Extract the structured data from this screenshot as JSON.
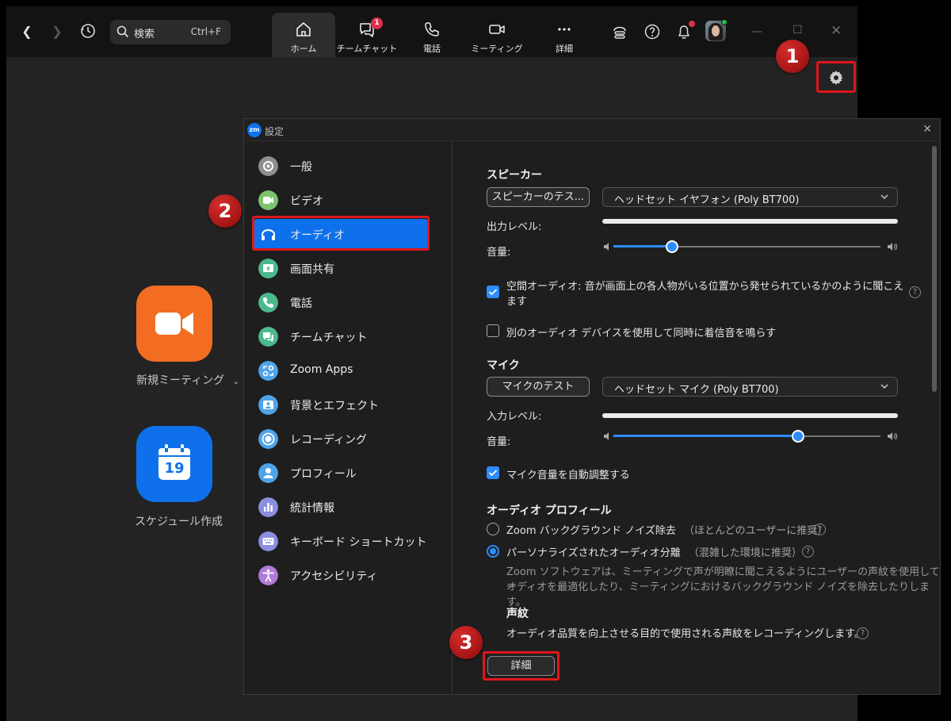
{
  "topbar": {
    "search_label": "検索",
    "search_shortcut": "Ctrl+F",
    "tabs": [
      {
        "label": "ホーム"
      },
      {
        "label": "チームチャット",
        "badge": "1"
      },
      {
        "label": "電話"
      },
      {
        "label": "ミーティング"
      },
      {
        "label": "詳細"
      }
    ]
  },
  "markers": [
    "1",
    "2",
    "3"
  ],
  "home": {
    "new_meeting_label": "新規ミーティング",
    "schedule_label": "スケジュール作成",
    "calendar_day": "19"
  },
  "settings": {
    "logo_text": "zm",
    "title": "設定",
    "sidebar": [
      {
        "label": "一般",
        "icon": "gear-icon",
        "color": "#8e8e8e"
      },
      {
        "label": "ビデオ",
        "icon": "video-icon",
        "color": "#7cc36e"
      },
      {
        "label": "オーディオ",
        "icon": "headphones-icon",
        "color": "#0e71eb",
        "active": true
      },
      {
        "label": "画面共有",
        "icon": "share-screen-icon",
        "color": "#4cb98d"
      },
      {
        "label": "電話",
        "icon": "phone-icon",
        "color": "#4cb98d"
      },
      {
        "label": "チームチャット",
        "icon": "chat-icon",
        "color": "#4cb98d"
      },
      {
        "label": "Zoom Apps",
        "icon": "apps-icon",
        "color": "#4fa3e8"
      },
      {
        "label": "背景とエフェクト",
        "icon": "background-icon",
        "color": "#4fa3e8"
      },
      {
        "label": "レコーディング",
        "icon": "record-icon",
        "color": "#4fa3e8"
      },
      {
        "label": "プロフィール",
        "icon": "profile-icon",
        "color": "#4fa3e8"
      },
      {
        "label": "統計情報",
        "icon": "stats-icon",
        "color": "#8b8fe0"
      },
      {
        "label": "キーボード ショートカット",
        "icon": "keyboard-icon",
        "color": "#8b8fe0"
      },
      {
        "label": "アクセシビリティ",
        "icon": "accessibility-icon",
        "color": "#b07ad6"
      }
    ],
    "audio": {
      "speaker_title": "スピーカー",
      "speaker_test": "スピーカーのテス...",
      "speaker_device": "ヘッドセット イヤフォン (Poly BT700)",
      "output_level_label": "出力レベル:",
      "speaker_volume_label": "音量:",
      "speaker_volume": 0.22,
      "spatial_audio_line1": "空間オーディオ: 音が画面上の各人物がいる位置から発せられているかのように聞こえ",
      "spatial_audio_line2": "ます",
      "spatial_audio_checked": true,
      "separate_ringtone": "別のオーディオ デバイスを使用して同時に着信音を鳴らす",
      "separate_ringtone_checked": false,
      "mic_title": "マイク",
      "mic_test": "マイクのテスト",
      "mic_device": "ヘッドセット マイク (Poly BT700)",
      "input_level_label": "入力レベル:",
      "mic_volume_label": "音量:",
      "mic_volume": 0.69,
      "auto_adjust": "マイク音量を自動調整する",
      "auto_adjust_checked": true,
      "profile_title": "オーディオ プロフィール",
      "zoom_noise_label": "Zoom バックグラウンド ノイズ除去",
      "zoom_noise_hint": "（ほとんどのユーザーに推奨）",
      "personalized_label": "パーソナライズされたオーディオ分離",
      "personalized_hint": "（混雑した環境に推奨）",
      "personalized_selected": true,
      "personalized_desc_line1": "Zoom ソフトウェアは、ミーティングで声が明瞭に聞こえるようにユーザーの声紋を使用してオ",
      "personalized_desc_line2": "ーディオを最適化したり、ミーティングにおけるバックグラウンド ノイズを除去したりします。",
      "voiceprint_title": "声紋",
      "voiceprint_desc": "オーディオ品質を向上させる目的で使用される声紋をレコーディングします。",
      "details_button": "詳細"
    }
  },
  "colors": {
    "accent": "#2d8cff",
    "highlight_red": "#e0161b",
    "zoom_orange": "#f26d21",
    "zoom_blue": "#0e71eb"
  }
}
